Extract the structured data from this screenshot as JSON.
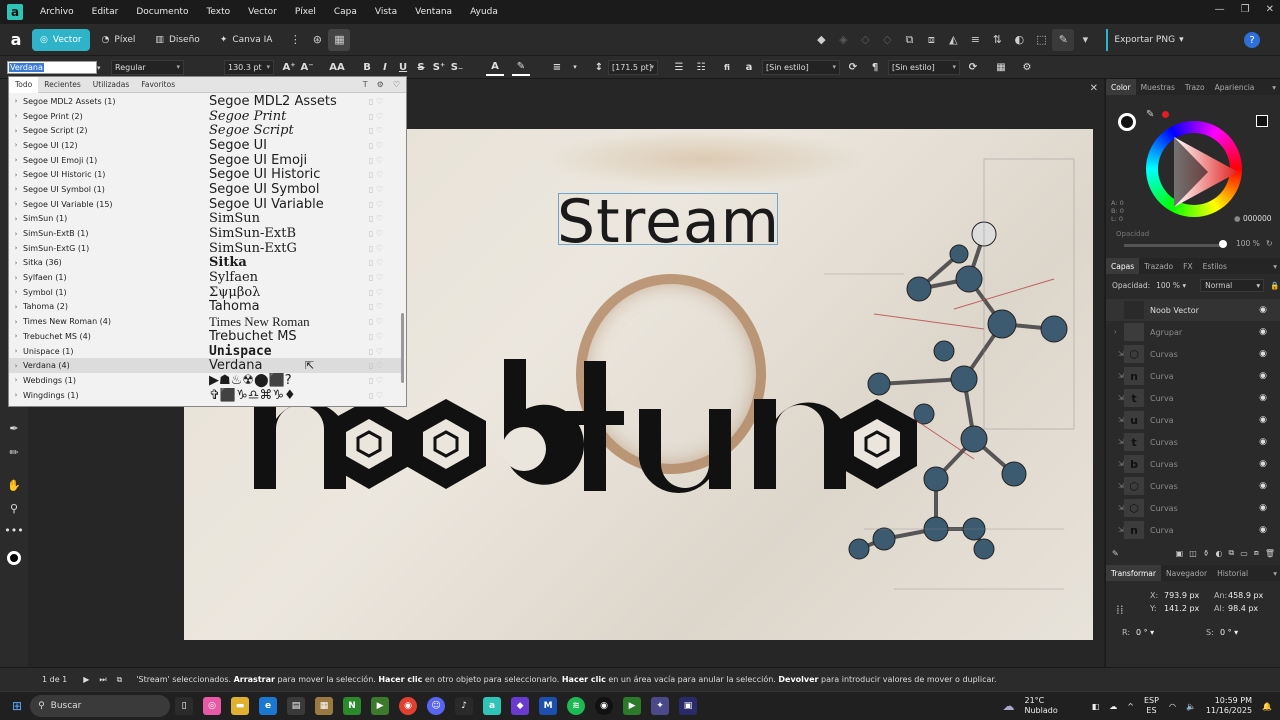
{
  "menubar": {
    "items": [
      "Archivo",
      "Editar",
      "Documento",
      "Texto",
      "Vector",
      "Píxel",
      "Capa",
      "Vista",
      "Ventana",
      "Ayuda"
    ]
  },
  "toolbar": {
    "personas": [
      "Vector",
      "Píxel",
      "Diseño",
      "Canva IA"
    ],
    "export_label": "Exportar PNG",
    "help": "?"
  },
  "context": {
    "font_name": "Verdana",
    "font_style": "Regular",
    "font_size": "130.3 pt",
    "leading": "[171.5 pt]",
    "char_style": "[Sin estilo]",
    "para_style": "[Sin estilo]",
    "aa": "AA"
  },
  "font_panel": {
    "tabs": [
      "Todo",
      "Recientes",
      "Utilizadas",
      "Favoritos"
    ],
    "fonts": [
      {
        "name": "Segoe MDL2 Assets (1)",
        "preview": "Segoe MDL2 Assets",
        "family": "\"DejaVu Sans\", sans-serif",
        "style": "normal"
      },
      {
        "name": "Segoe Print (2)",
        "preview": "Segoe Print",
        "family": "\"DejaVu Serif\", serif",
        "style": "italic"
      },
      {
        "name": "Segoe Script (2)",
        "preview": "Segoe Script",
        "family": "\"DejaVu Serif\", serif",
        "style": "italic"
      },
      {
        "name": "Segoe UI (12)",
        "preview": "Segoe UI",
        "family": "\"DejaVu Sans\", sans-serif",
        "style": "normal"
      },
      {
        "name": "Segoe UI Emoji (1)",
        "preview": "Segoe UI Emoji",
        "family": "\"DejaVu Sans\", sans-serif",
        "style": "normal"
      },
      {
        "name": "Segoe UI Historic (1)",
        "preview": "Segoe UI Historic",
        "family": "\"DejaVu Sans\", sans-serif",
        "style": "normal"
      },
      {
        "name": "Segoe UI Symbol (1)",
        "preview": "Segoe UI Symbol",
        "family": "\"DejaVu Sans\", sans-serif",
        "style": "normal"
      },
      {
        "name": "Segoe UI Variable (15)",
        "preview": "Segoe UI Variable",
        "family": "\"DejaVu Sans\", sans-serif",
        "style": "normal"
      },
      {
        "name": "SimSun (1)",
        "preview": "SimSun",
        "family": "\"DejaVu Serif\", serif",
        "style": "normal"
      },
      {
        "name": "SimSun-ExtB (1)",
        "preview": "SimSun-ExtB",
        "family": "\"DejaVu Serif\", serif",
        "style": "normal"
      },
      {
        "name": "SimSun-ExtG (1)",
        "preview": "SimSun-ExtG",
        "family": "\"DejaVu Serif\", serif",
        "style": "normal"
      },
      {
        "name": "Sitka (36)",
        "preview": "Sitka",
        "family": "\"DejaVu Serif\", serif",
        "style": "bold"
      },
      {
        "name": "Sylfaen (1)",
        "preview": "Sylfaen",
        "family": "\"DejaVu Serif\", serif",
        "style": "normal"
      },
      {
        "name": "Symbol (1)",
        "preview": "Σψμβολ",
        "family": "\"DejaVu Serif\", serif",
        "style": "normal"
      },
      {
        "name": "Tahoma (2)",
        "preview": "Tahoma",
        "family": "\"DejaVu Sans\", sans-serif",
        "style": "normal"
      },
      {
        "name": "Times New Roman (4)",
        "preview": "Times New Roman",
        "family": "\"Liberation Serif\", serif",
        "style": "normal"
      },
      {
        "name": "Trebuchet MS (4)",
        "preview": "Trebuchet MS",
        "family": "\"DejaVu Sans\", sans-serif",
        "style": "normal"
      },
      {
        "name": "Unispace (1)",
        "preview": "Unispace",
        "family": "\"DejaVu Sans Mono\", monospace",
        "style": "bold"
      },
      {
        "name": "Verdana (4)",
        "preview": "Verdana",
        "family": "\"DejaVu Sans\", sans-serif",
        "style": "normal",
        "highlighted": true
      },
      {
        "name": "Webdings (1)",
        "preview": "▶☗♨☢⬤⬛?",
        "family": "\"DejaVu Sans\", sans-serif",
        "style": "normal"
      },
      {
        "name": "Wingdings (1)",
        "preview": "✞⬛♑♎⌘♑♦",
        "family": "\"DejaVu Sans\", sans-serif",
        "style": "normal"
      }
    ]
  },
  "canvas": {
    "stream_text": "Stream",
    "brand_text": "noobtuno"
  },
  "right_panel": {
    "color_tabs": [
      "Color",
      "Muestras",
      "Trazo",
      "Apariencia"
    ],
    "hex": "000000",
    "opacity_label": "Opacidad",
    "opacity_pct": "100 %",
    "lab": [
      "A: 0",
      "B: 0",
      "L: 0"
    ],
    "layer_tabs": [
      "Capas",
      "Trazado",
      "FX",
      "Estilos"
    ],
    "layer_opacity_label": "Opacidad:",
    "layer_opacity": "100 %",
    "blend_mode": "Normal",
    "layers": [
      {
        "name": "Noob Vector",
        "indent": 0,
        "dim": false,
        "glyph": ""
      },
      {
        "name": "Agrupar",
        "indent": 1,
        "dim": true,
        "glyph": ""
      },
      {
        "name": "Curvas",
        "indent": 2,
        "dim": true,
        "glyph": "⬡"
      },
      {
        "name": "Curva",
        "indent": 2,
        "dim": true,
        "glyph": "n"
      },
      {
        "name": "Curva",
        "indent": 2,
        "dim": true,
        "glyph": "t"
      },
      {
        "name": "Curva",
        "indent": 2,
        "dim": true,
        "glyph": "u"
      },
      {
        "name": "Curvas",
        "indent": 2,
        "dim": true,
        "glyph": "t"
      },
      {
        "name": "Curvas",
        "indent": 2,
        "dim": true,
        "glyph": "b"
      },
      {
        "name": "Curvas",
        "indent": 2,
        "dim": true,
        "glyph": "⬡"
      },
      {
        "name": "Curvas",
        "indent": 2,
        "dim": true,
        "glyph": "⬡"
      },
      {
        "name": "Curva",
        "indent": 2,
        "dim": true,
        "glyph": "n"
      }
    ],
    "transform_tabs": [
      "Transformar",
      "Navegador",
      "Historial"
    ],
    "x_label": "X:",
    "x": "793.9 px",
    "y_label": "Y:",
    "y": "141.2 px",
    "w_label": "An:",
    "w": "458.9 px",
    "h_label": "Al:",
    "h": "98.4 px",
    "r_label": "R:",
    "r": "0 °",
    "s_label": "S:",
    "s": "0 °"
  },
  "status": {
    "page": "1 de 1",
    "message_parts": [
      "'Stream' seleccionados. ",
      "Arrastrar",
      " para mover la selección. ",
      "Hacer clic",
      " en otro objeto para seleccionarlo. ",
      "Hacer clic",
      " en un área vacía para anular la selección. ",
      "Devolver",
      " para introducir valores de mover o duplicar."
    ]
  },
  "taskbar": {
    "search": "Buscar",
    "weather_temp": "21°C",
    "weather_desc": "Nublado",
    "lang1": "ESP",
    "lang2": "ES",
    "time": "10:59 PM",
    "date": "11/16/2025"
  }
}
